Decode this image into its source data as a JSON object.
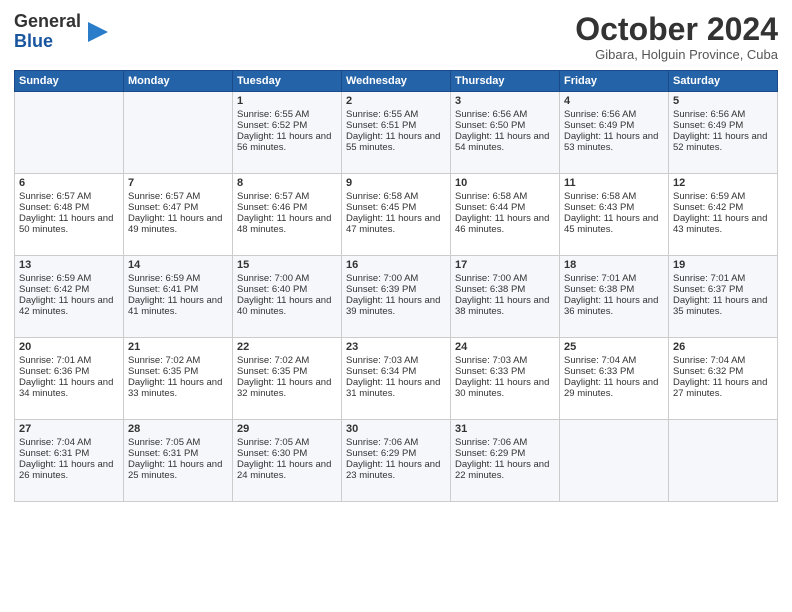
{
  "header": {
    "logo_line1": "General",
    "logo_line2": "Blue",
    "month": "October 2024",
    "location": "Gibara, Holguin Province, Cuba"
  },
  "days_of_week": [
    "Sunday",
    "Monday",
    "Tuesday",
    "Wednesday",
    "Thursday",
    "Friday",
    "Saturday"
  ],
  "weeks": [
    [
      {
        "day": "",
        "data": ""
      },
      {
        "day": "",
        "data": ""
      },
      {
        "day": "1",
        "data": "Sunrise: 6:55 AM\nSunset: 6:52 PM\nDaylight: 11 hours and 56 minutes."
      },
      {
        "day": "2",
        "data": "Sunrise: 6:55 AM\nSunset: 6:51 PM\nDaylight: 11 hours and 55 minutes."
      },
      {
        "day": "3",
        "data": "Sunrise: 6:56 AM\nSunset: 6:50 PM\nDaylight: 11 hours and 54 minutes."
      },
      {
        "day": "4",
        "data": "Sunrise: 6:56 AM\nSunset: 6:49 PM\nDaylight: 11 hours and 53 minutes."
      },
      {
        "day": "5",
        "data": "Sunrise: 6:56 AM\nSunset: 6:49 PM\nDaylight: 11 hours and 52 minutes."
      }
    ],
    [
      {
        "day": "6",
        "data": "Sunrise: 6:57 AM\nSunset: 6:48 PM\nDaylight: 11 hours and 50 minutes."
      },
      {
        "day": "7",
        "data": "Sunrise: 6:57 AM\nSunset: 6:47 PM\nDaylight: 11 hours and 49 minutes."
      },
      {
        "day": "8",
        "data": "Sunrise: 6:57 AM\nSunset: 6:46 PM\nDaylight: 11 hours and 48 minutes."
      },
      {
        "day": "9",
        "data": "Sunrise: 6:58 AM\nSunset: 6:45 PM\nDaylight: 11 hours and 47 minutes."
      },
      {
        "day": "10",
        "data": "Sunrise: 6:58 AM\nSunset: 6:44 PM\nDaylight: 11 hours and 46 minutes."
      },
      {
        "day": "11",
        "data": "Sunrise: 6:58 AM\nSunset: 6:43 PM\nDaylight: 11 hours and 45 minutes."
      },
      {
        "day": "12",
        "data": "Sunrise: 6:59 AM\nSunset: 6:42 PM\nDaylight: 11 hours and 43 minutes."
      }
    ],
    [
      {
        "day": "13",
        "data": "Sunrise: 6:59 AM\nSunset: 6:42 PM\nDaylight: 11 hours and 42 minutes."
      },
      {
        "day": "14",
        "data": "Sunrise: 6:59 AM\nSunset: 6:41 PM\nDaylight: 11 hours and 41 minutes."
      },
      {
        "day": "15",
        "data": "Sunrise: 7:00 AM\nSunset: 6:40 PM\nDaylight: 11 hours and 40 minutes."
      },
      {
        "day": "16",
        "data": "Sunrise: 7:00 AM\nSunset: 6:39 PM\nDaylight: 11 hours and 39 minutes."
      },
      {
        "day": "17",
        "data": "Sunrise: 7:00 AM\nSunset: 6:38 PM\nDaylight: 11 hours and 38 minutes."
      },
      {
        "day": "18",
        "data": "Sunrise: 7:01 AM\nSunset: 6:38 PM\nDaylight: 11 hours and 36 minutes."
      },
      {
        "day": "19",
        "data": "Sunrise: 7:01 AM\nSunset: 6:37 PM\nDaylight: 11 hours and 35 minutes."
      }
    ],
    [
      {
        "day": "20",
        "data": "Sunrise: 7:01 AM\nSunset: 6:36 PM\nDaylight: 11 hours and 34 minutes."
      },
      {
        "day": "21",
        "data": "Sunrise: 7:02 AM\nSunset: 6:35 PM\nDaylight: 11 hours and 33 minutes."
      },
      {
        "day": "22",
        "data": "Sunrise: 7:02 AM\nSunset: 6:35 PM\nDaylight: 11 hours and 32 minutes."
      },
      {
        "day": "23",
        "data": "Sunrise: 7:03 AM\nSunset: 6:34 PM\nDaylight: 11 hours and 31 minutes."
      },
      {
        "day": "24",
        "data": "Sunrise: 7:03 AM\nSunset: 6:33 PM\nDaylight: 11 hours and 30 minutes."
      },
      {
        "day": "25",
        "data": "Sunrise: 7:04 AM\nSunset: 6:33 PM\nDaylight: 11 hours and 29 minutes."
      },
      {
        "day": "26",
        "data": "Sunrise: 7:04 AM\nSunset: 6:32 PM\nDaylight: 11 hours and 27 minutes."
      }
    ],
    [
      {
        "day": "27",
        "data": "Sunrise: 7:04 AM\nSunset: 6:31 PM\nDaylight: 11 hours and 26 minutes."
      },
      {
        "day": "28",
        "data": "Sunrise: 7:05 AM\nSunset: 6:31 PM\nDaylight: 11 hours and 25 minutes."
      },
      {
        "day": "29",
        "data": "Sunrise: 7:05 AM\nSunset: 6:30 PM\nDaylight: 11 hours and 24 minutes."
      },
      {
        "day": "30",
        "data": "Sunrise: 7:06 AM\nSunset: 6:29 PM\nDaylight: 11 hours and 23 minutes."
      },
      {
        "day": "31",
        "data": "Sunrise: 7:06 AM\nSunset: 6:29 PM\nDaylight: 11 hours and 22 minutes."
      },
      {
        "day": "",
        "data": ""
      },
      {
        "day": "",
        "data": ""
      }
    ]
  ]
}
